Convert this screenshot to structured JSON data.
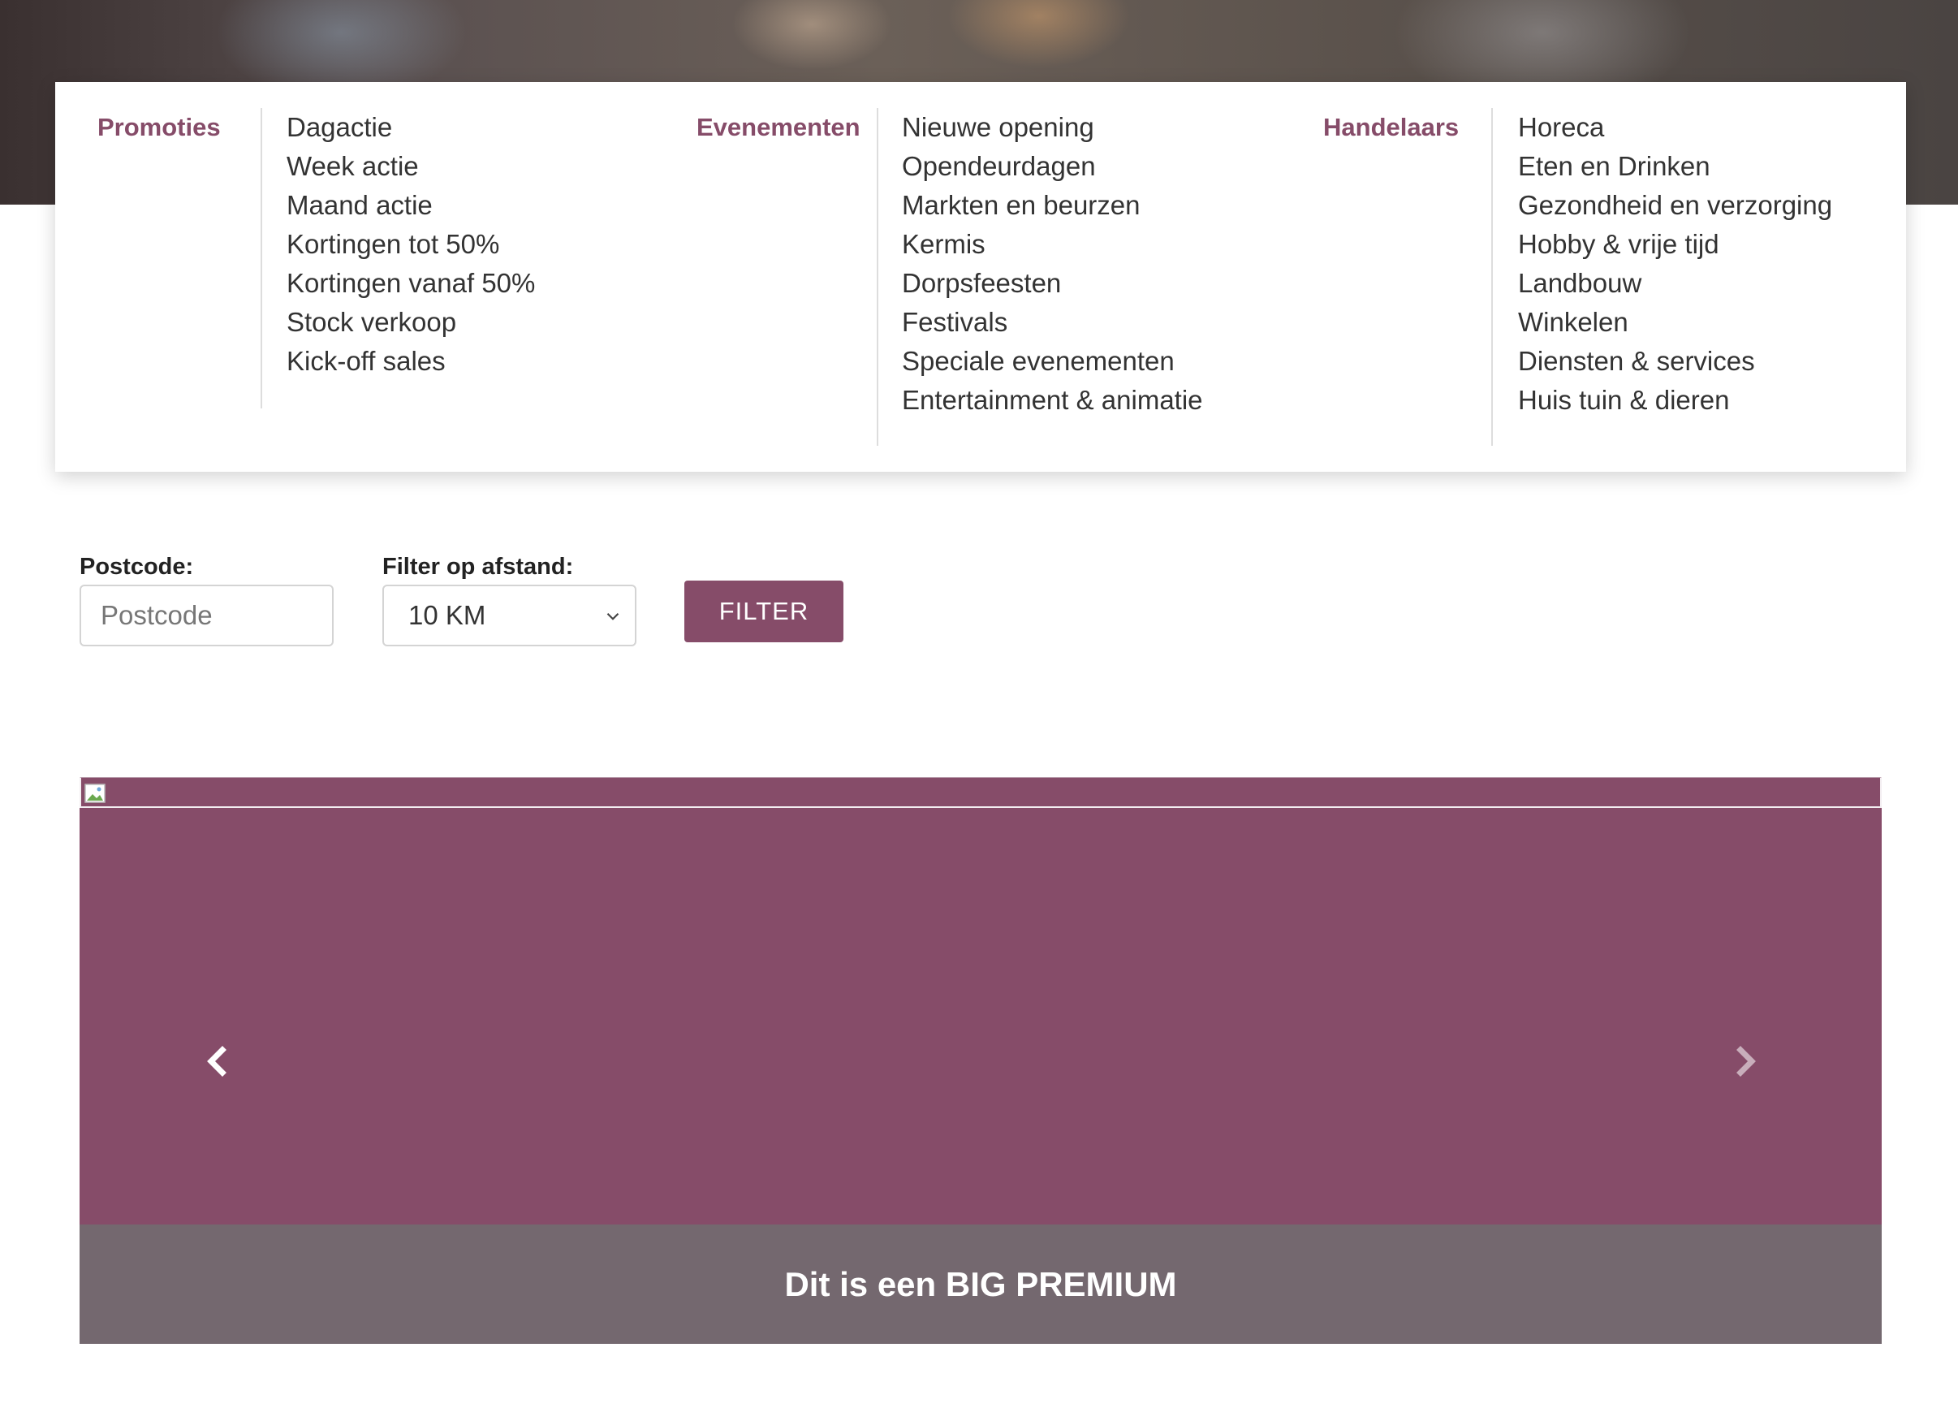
{
  "hero": {
    "alt": "banner photo"
  },
  "menu": {
    "groups": [
      {
        "title": "Promoties",
        "items": [
          "Dagactie",
          "Week actie",
          "Maand actie",
          "Kortingen tot 50%",
          "Kortingen vanaf 50%",
          "Stock verkoop",
          "Kick-off sales"
        ]
      },
      {
        "title": "Evenementen",
        "items": [
          "Nieuwe opening",
          "Opendeurdagen",
          "Markten en beurzen",
          "Kermis",
          "Dorpsfeesten",
          "Festivals",
          "Speciale evenementen",
          "Entertainment & animatie"
        ]
      },
      {
        "title": "Handelaars",
        "items": [
          "Horeca",
          "Eten en Drinken",
          "Gezondheid en verzorging",
          "Hobby & vrije tijd",
          "Landbouw",
          "Winkelen",
          "Diensten & services",
          "Huis tuin & dieren"
        ]
      }
    ]
  },
  "filter": {
    "postcode_label": "Postcode:",
    "postcode_placeholder": "Postcode",
    "postcode_value": "",
    "distance_label": "Filter op afstand:",
    "distance_selected": "10 KM",
    "button_label": "FILTER"
  },
  "carousel": {
    "caption": "Dit is een BIG PREMIUM",
    "prev_icon": "chevron-left-icon",
    "next_icon": "chevron-right-icon"
  },
  "colors": {
    "brand": "#864c69",
    "caption_bg": "#74686f"
  }
}
